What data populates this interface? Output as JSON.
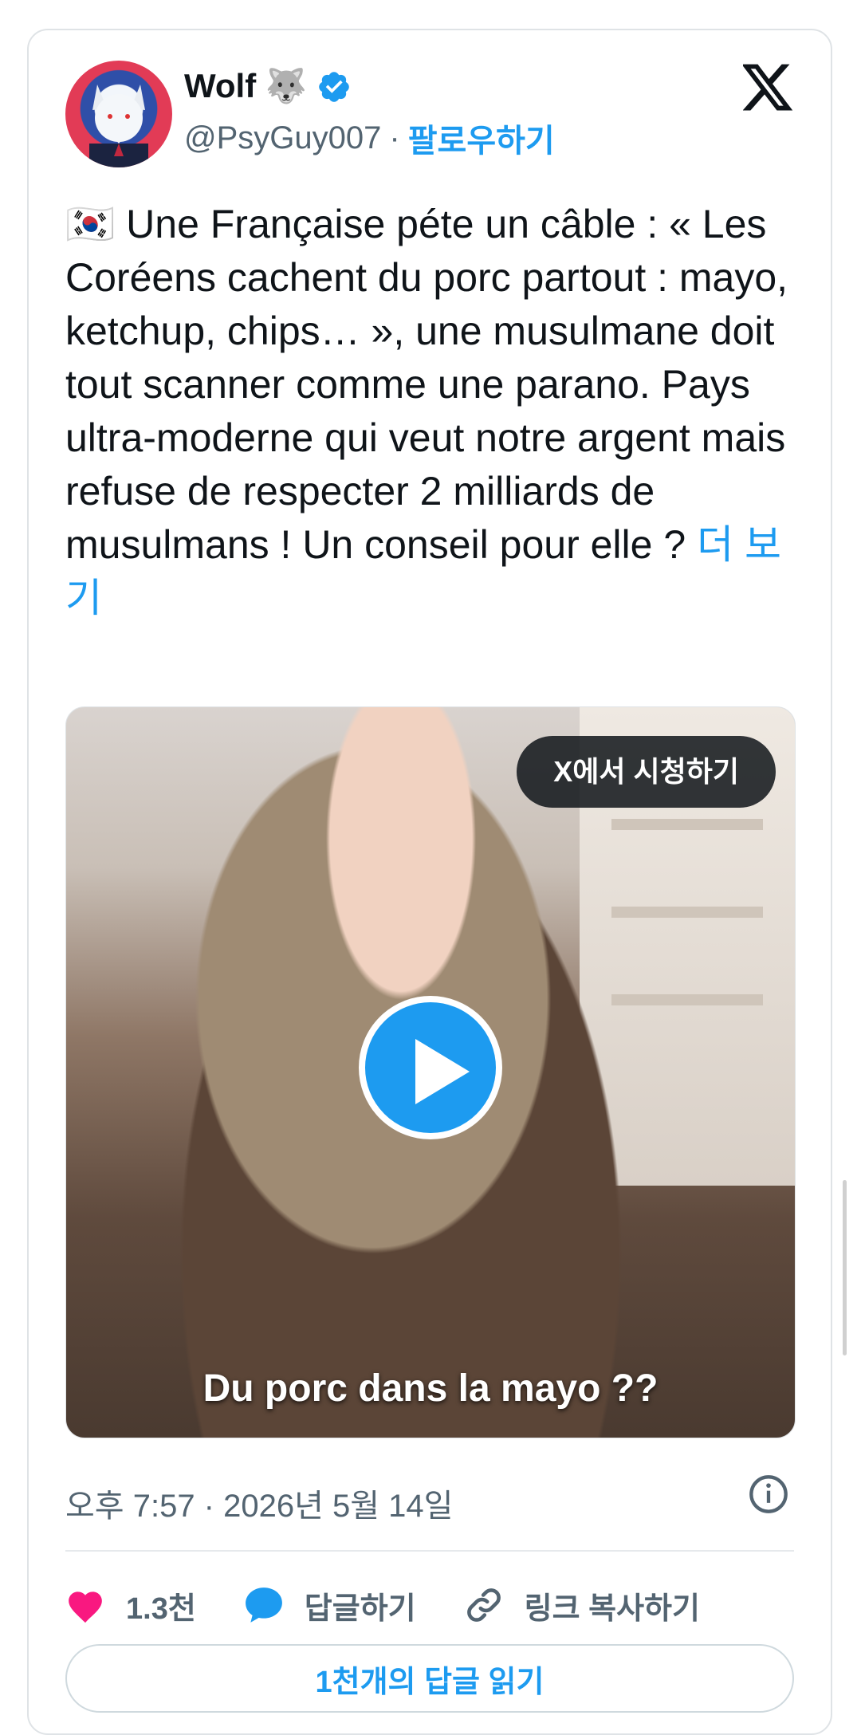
{
  "tweet": {
    "author_name": "Wolf 🐺",
    "handle": "@PsyGuy007",
    "separator": "·",
    "follow_label": "팔로우하기",
    "text": "🇰🇷 Une Française péte un câble : « Les  Coréens cachent du porc partout : mayo, ketchup, chips… », une musulmane doit tout scanner comme une parano. Pays ultra-moderne qui veut notre argent mais refuse de respecter 2 milliards de musulmans ! Un conseil pour elle ?",
    "more_label": "더 보기",
    "media": {
      "watch_label": "X에서 시청하기",
      "caption": "Du porc dans la mayo ??"
    },
    "timestamp": "오후 7:57 · 2026년 5월 14일",
    "actions": {
      "like_count": "1.3천",
      "reply_label": "답글하기",
      "copy_link_label": "링크 복사하기"
    },
    "read_replies_label": "1천개의 답글 읽기"
  },
  "icons": {
    "verified": "verified-badge-icon",
    "x_logo": "x-logo-icon",
    "info": "info-icon",
    "heart": "heart-icon",
    "reply": "reply-bubble-icon",
    "link": "link-icon",
    "play": "play-icon"
  },
  "colors": {
    "accent": "#1d9bf0",
    "like": "#f91880",
    "muted": "#536471"
  }
}
